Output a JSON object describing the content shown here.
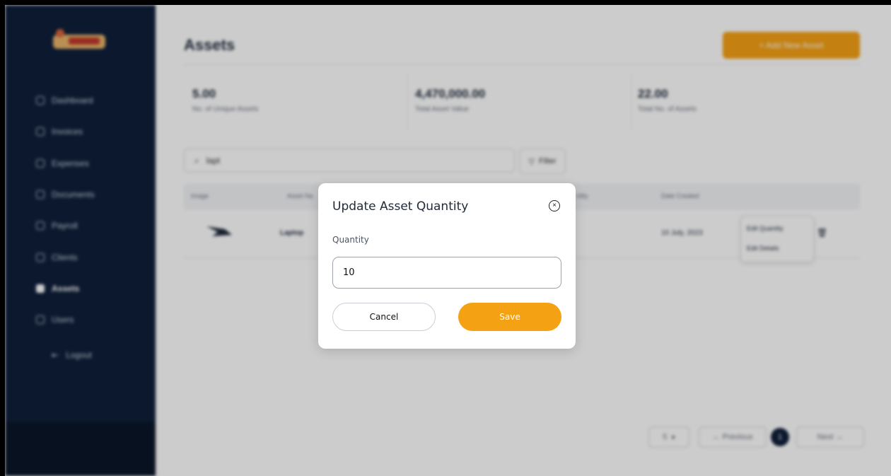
{
  "sidebar": {
    "items": [
      {
        "label": "Dashboard",
        "icon": "home-icon"
      },
      {
        "label": "Invoices",
        "icon": "invoice-icon"
      },
      {
        "label": "Expenses",
        "icon": "wallet-icon"
      },
      {
        "label": "Documents",
        "icon": "document-icon"
      },
      {
        "label": "Payroll",
        "icon": "payroll-icon"
      },
      {
        "label": "Clients",
        "icon": "clients-icon"
      },
      {
        "label": "Assets",
        "icon": "assets-icon",
        "active": true
      },
      {
        "label": "Users",
        "icon": "users-icon"
      }
    ],
    "logout": "Logout"
  },
  "header": {
    "title": "Assets",
    "add_button": "+ Add New Asset"
  },
  "stats": [
    {
      "value": "5.00",
      "label": "No. of Unique Assets"
    },
    {
      "value": "4,470,000.00",
      "label": "Total Asset Value"
    },
    {
      "value": "22.00",
      "label": "Total No. of Assets"
    }
  ],
  "search": {
    "value": "lapt"
  },
  "filter_label": "Filter",
  "table": {
    "headers": [
      "Image",
      "Asset Na",
      "ntity",
      "Date Created"
    ],
    "rows": [
      {
        "name": "Laptop",
        "date": "10 July, 2023"
      }
    ]
  },
  "row_menu": [
    "Edit Quantity",
    "Edit Details"
  ],
  "pagination": {
    "page_size": "5",
    "previous": "← Previous",
    "current": "1",
    "next": "Next →"
  },
  "modal": {
    "title": "Update Asset Quantity",
    "close_symbol": "×",
    "quantity_label": "Quantity",
    "quantity_value": "10",
    "cancel": "Cancel",
    "save": "Save"
  },
  "colors": {
    "accent": "#f5a114",
    "sidebar": "#0f1f3a"
  }
}
